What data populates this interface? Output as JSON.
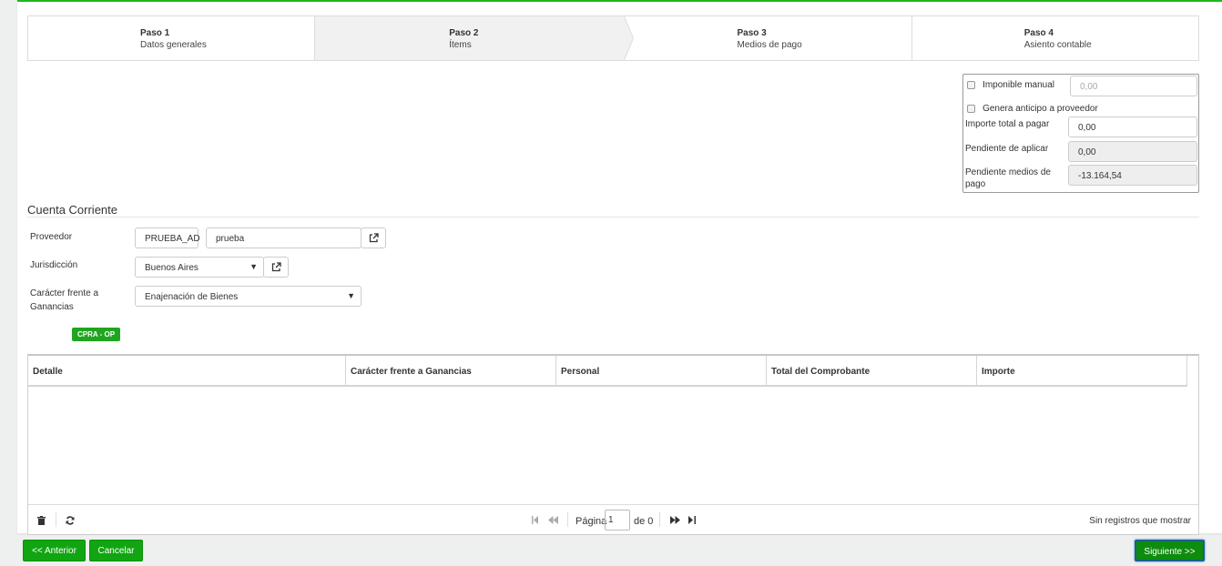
{
  "wizard": {
    "steps": [
      {
        "num": "Paso 1",
        "label": "Datos generales"
      },
      {
        "num": "Paso 2",
        "label": "Ítems"
      },
      {
        "num": "Paso 3",
        "label": "Medios de pago"
      },
      {
        "num": "Paso 4",
        "label": "Asiento contable"
      }
    ],
    "active_step": 2
  },
  "totals": {
    "imponible_manual_label": "Imponible manual",
    "imponible_manual_value": "0,00",
    "anticipo_label": "Genera anticipo a proveedor",
    "importe_total_label": "Importe total a pagar",
    "importe_total_value": "0,00",
    "pendiente_aplicar_label": "Pendiente de aplicar",
    "pendiente_aplicar_value": "0,00",
    "pendiente_medios_label": "Pendiente medios de pago",
    "pendiente_medios_value": "-13.164,54"
  },
  "cuenta": {
    "title": "Cuenta Corriente",
    "proveedor_label": "Proveedor",
    "proveedor_code": "PRUEBA_AD",
    "proveedor_name": "prueba",
    "jurisdiccion_label": "Jurisdicción",
    "jurisdiccion_value": "Buenos Aires",
    "caracter_label_1": "Carácter frente a",
    "caracter_label_2": "Ganancias",
    "caracter_value": "Enajenación de Bienes",
    "tag": "CPRA - OP"
  },
  "grid": {
    "columns": [
      "Detalle",
      "Carácter frente a Ganancias",
      "Personal",
      "Total del Comprobante",
      "Importe"
    ],
    "rows": [],
    "page_label": "Página",
    "page_value": "1",
    "of_label": "de 0",
    "empty_text": "Sin registros que mostrar"
  },
  "buttons": {
    "prev": "<< Anterior",
    "cancel": "Cancelar",
    "next": "Siguiente >>"
  },
  "colors": {
    "accent": "#11a611",
    "active_step_bg": "#f1f1f1"
  }
}
